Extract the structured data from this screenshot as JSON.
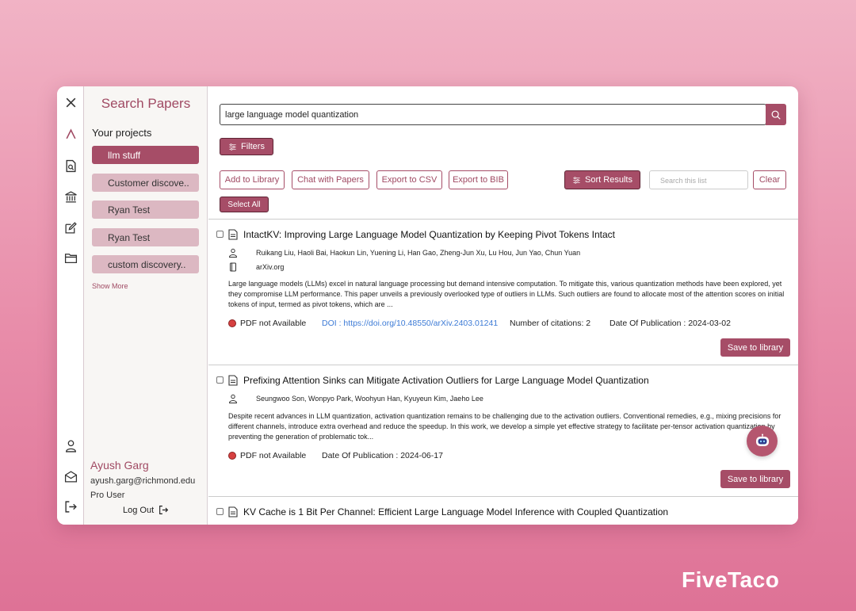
{
  "sidebar": {
    "title": "Search Papers",
    "projects_header": "Your projects",
    "projects": [
      {
        "label": "llm stuff"
      },
      {
        "label": "Customer discove.."
      },
      {
        "label": "Ryan Test"
      },
      {
        "label": "Ryan Test"
      },
      {
        "label": "custom discovery.."
      }
    ],
    "show_more": "Show More",
    "user": {
      "name": "Ayush Garg",
      "email": "ayush.garg@richmond.edu",
      "plan": "Pro User",
      "logout_label": "Log Out"
    }
  },
  "iconbar": {
    "icons": [
      "close-icon",
      "logo-caret-icon",
      "search-document-icon",
      "library-building-icon",
      "edit-icon",
      "folder-icon",
      "user-icon",
      "inbox-icon",
      "logout-icon"
    ]
  },
  "search": {
    "query": "large language model quantization",
    "filters_label": "Filters"
  },
  "toolbar": {
    "add_to_library": "Add to Library",
    "chat_with_papers": "Chat with Papers",
    "export_csv": "Export to CSV",
    "export_bib": "Export to BIB",
    "sort_results": "Sort Results",
    "list_search_placeholder": "Search this list",
    "clear": "Clear",
    "select_all": "Select All"
  },
  "papers": [
    {
      "title": "IntactKV: Improving Large Language Model Quantization by Keeping Pivot Tokens Intact",
      "authors": "Ruikang Liu, Haoli Bai, Haokun Lin, Yuening Li, Han Gao, Zheng-Jun Xu, Lu Hou, Jun Yao, Chun Yuan",
      "source": "arXiv.org",
      "abstract": "Large language models (LLMs) excel in natural language processing but demand intensive computation. To mitigate this, various quantization methods have been explored, yet they compromise LLM performance. This paper unveils a previously overlooked type of outliers in LLMs. Such outliers are found to allocate most of the attention scores on initial tokens of input, termed as pivot tokens, which are ...",
      "pdf_status": "PDF not Available",
      "doi": "DOI : https://doi.org/10.48550/arXiv.2403.01241",
      "citations": "Number of citations: 2",
      "date": "Date Of Publication : 2024-03-02",
      "save_label": "Save to library"
    },
    {
      "title": "Prefixing Attention Sinks can Mitigate Activation Outliers for Large Language Model Quantization",
      "authors": "Seungwoo Son, Wonpyo Park, Woohyun Han, Kyuyeun Kim, Jaeho Lee",
      "abstract": "Despite recent advances in LLM quantization, activation quantization remains to be challenging due to the activation outliers. Conventional remedies, e.g., mixing precisions for different channels, introduce extra overhead and reduce the speedup. In this work, we develop a simple yet effective strategy to facilitate per-tensor activation quantization by preventing the generation of problematic tok...",
      "pdf_status": "PDF not Available",
      "date": "Date Of Publication : 2024-06-17",
      "save_label": "Save to library"
    },
    {
      "title": "KV Cache is 1 Bit Per Channel: Efficient Large Language Model Inference with Coupled Quantization"
    }
  ],
  "brand": "FiveTaco",
  "colors": {
    "accent": "#a64d67",
    "accent_light": "#dcb8c2",
    "link": "#3d7bd6",
    "status_red": "#d64040"
  }
}
